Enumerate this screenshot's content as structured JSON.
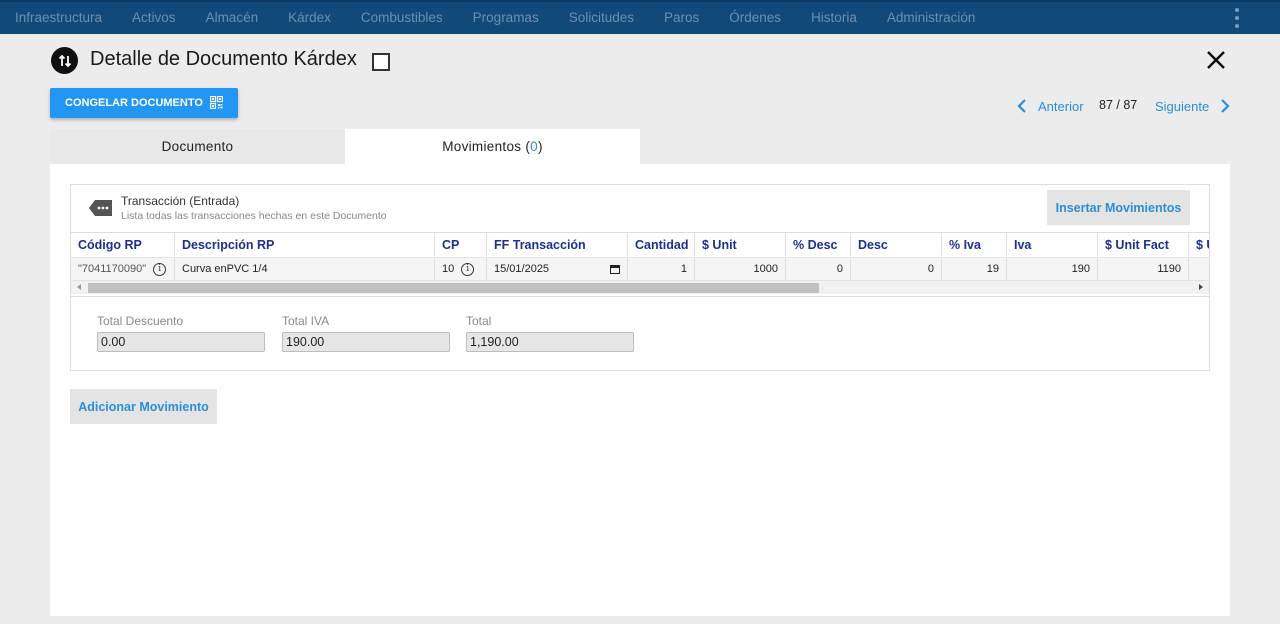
{
  "topnav": {
    "items": [
      "Infraestructura",
      "Activos",
      "Almacén",
      "Kárdex",
      "Combustibles",
      "Programas",
      "Solicitudes",
      "Paros",
      "Órdenes",
      "Historia",
      "Administración"
    ]
  },
  "header": {
    "title": "Detalle de Documento Kárdex",
    "freeze_label": "CONGELAR DOCUMENTO"
  },
  "pager": {
    "prev_label": "Anterior",
    "position": "87 / 87",
    "next_label": "Siguiente"
  },
  "tabs": {
    "documento": "Documento",
    "movimientos_label": "Movimientos (",
    "movimientos_count": "0",
    "movimientos_close": ")"
  },
  "transaction": {
    "title": "Transacción (Entrada)",
    "subtitle": "Lista todas las transacciones hechas en este Documento",
    "insert_label": "Insertar Movimientos"
  },
  "table": {
    "columns": [
      "Código RP",
      "Descripción RP",
      "CP",
      "FF Transacción",
      "Cantidad",
      "$ Unit",
      "% Desc",
      "Desc",
      "% Iva",
      "Iva",
      "$ Unit Fact",
      "$ U"
    ],
    "row": {
      "codigo": "\"7041170090\"",
      "descripcion": "Curva enPVC 1/4",
      "cp": "10",
      "fecha": "15/01/2025",
      "cantidad": "1",
      "unit": "1000",
      "pct_desc": "0",
      "desc": "0",
      "pct_iva": "19",
      "iva": "190",
      "unit_fact": "1190"
    }
  },
  "totals": {
    "descuento_label": "Total Descuento",
    "descuento_value": "0.00",
    "iva_label": "Total IVA",
    "iva_value": "190.00",
    "total_label": "Total",
    "total_value": "1,190.00"
  },
  "actions": {
    "add_label": "Adicionar Movimiento"
  }
}
